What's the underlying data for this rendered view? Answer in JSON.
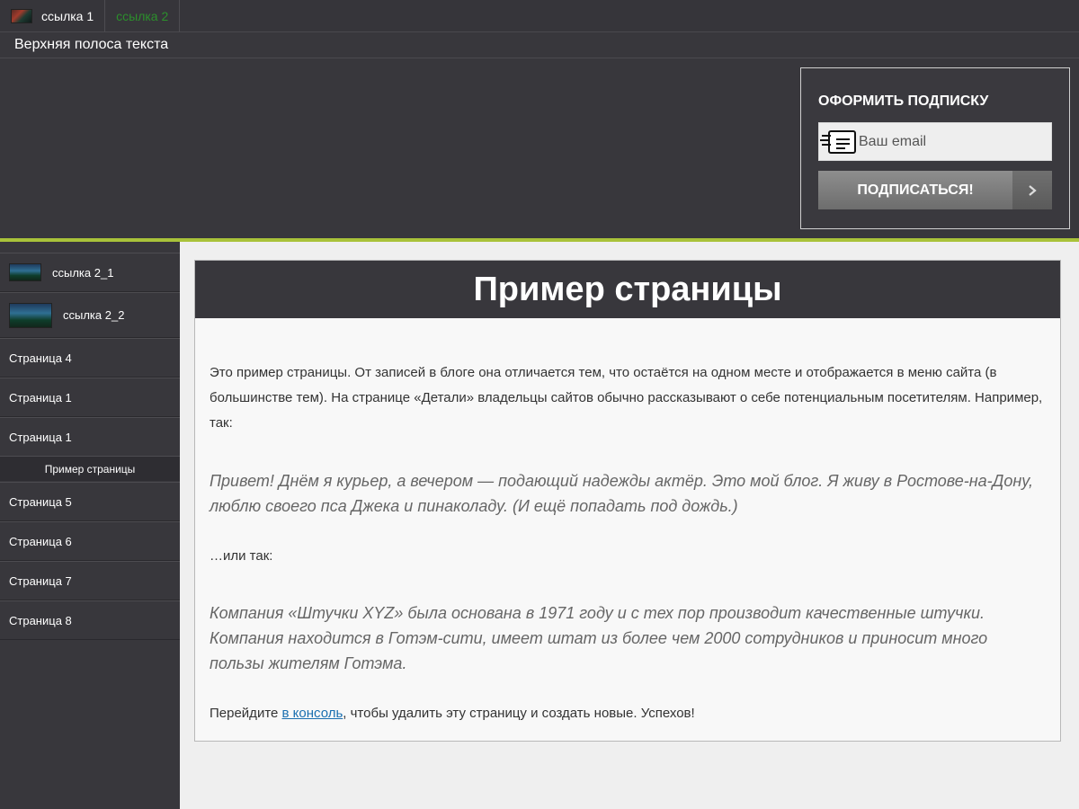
{
  "topnav": {
    "tabs": [
      {
        "label": "ссылка 1"
      },
      {
        "label": "ссылка 2"
      }
    ]
  },
  "top_strip": {
    "text": "Верхняя полоса текста"
  },
  "subscribe": {
    "title": "ОФОРМИТЬ ПОДПИСКУ",
    "email_placeholder": "Ваш email",
    "button_label": "ПОДПИСАТЬСЯ!"
  },
  "sidebar": {
    "items": [
      {
        "label": "ссылка 2_1"
      },
      {
        "label": "ссылка 2_2"
      },
      {
        "label": "Страница 4"
      },
      {
        "label": "Страница 1"
      },
      {
        "label": "Страница 1"
      },
      {
        "label": "Пример страницы"
      },
      {
        "label": "Страница 5"
      },
      {
        "label": "Страница 6"
      },
      {
        "label": "Страница 7"
      },
      {
        "label": "Страница 8"
      }
    ]
  },
  "content": {
    "title": "Пример страницы",
    "intro": "Это пример страницы. От записей в блоге она отличается тем, что остаётся на одном месте и отображается в меню сайта (в большинстве тем). На странице «Детали» владельцы сайтов обычно рассказывают о себе потенциальным посетителям. Например, так:",
    "quote1": "Привет! Днём я курьер, а вечером — подающий надежды актёр. Это мой блог. Я живу в Ростове-на-Дону, люблю своего пса Джека и пинаколаду. (И ещё попадать под дождь.)",
    "or_text": "…или так:",
    "quote2": "Компания «Штучки XYZ» была основана в 1971 году и с тех пор производит качественные штучки. Компания находится в Готэм-сити, имеет штат из более чем 2000 сотрудников и приносит много пользы жителям Готэма.",
    "outro_before": "Перейдите ",
    "outro_link": "в консоль",
    "outro_after": ", чтобы удалить эту страницу и создать новые. Успехов!"
  }
}
